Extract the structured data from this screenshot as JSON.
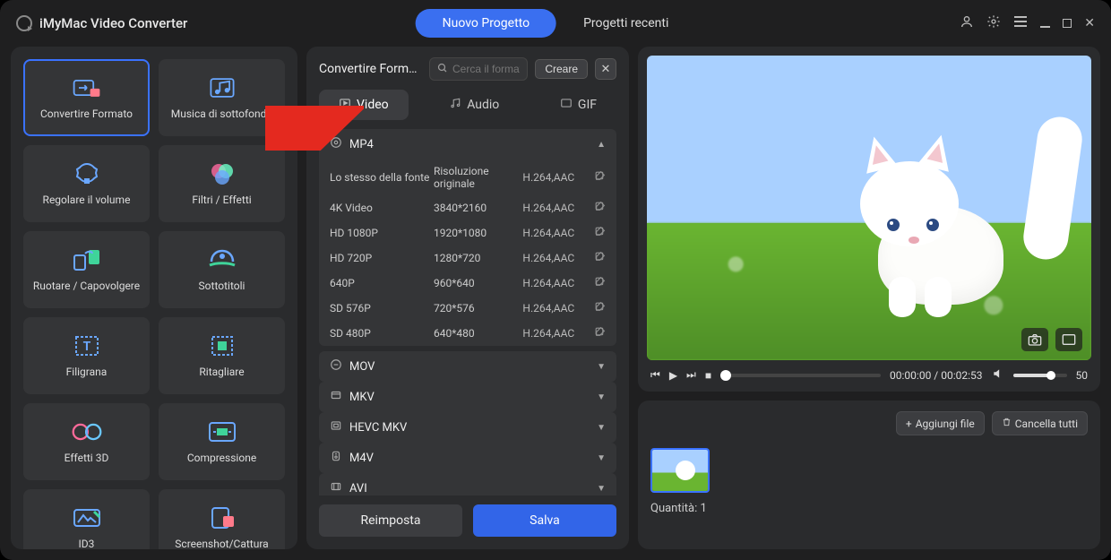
{
  "app": {
    "title": "iMyMac Video Converter"
  },
  "topTabs": {
    "new": "Nuovo Progetto",
    "recent": "Progetti recenti"
  },
  "tools": [
    {
      "id": "convert",
      "label": "Convertire Formato",
      "active": true
    },
    {
      "id": "bgmusic",
      "label": "Musica di sottofondo"
    },
    {
      "id": "volume",
      "label": "Regolare il volume"
    },
    {
      "id": "filters",
      "label": "Filtri / Effetti"
    },
    {
      "id": "rotate",
      "label": "Ruotare / Capovolgere"
    },
    {
      "id": "subs",
      "label": "Sottotitoli"
    },
    {
      "id": "watermark",
      "label": "Filigrana"
    },
    {
      "id": "crop",
      "label": "Ritagliare"
    },
    {
      "id": "fx3d",
      "label": "Effetti 3D"
    },
    {
      "id": "compress",
      "label": "Compressione"
    },
    {
      "id": "id3",
      "label": "ID3"
    },
    {
      "id": "screenshot",
      "label": "Screenshot/Cattura"
    }
  ],
  "center": {
    "title": "Convertire Forma...",
    "searchPlaceholder": "Cerca il formato",
    "create": "Creare",
    "tabs": {
      "video": "Video",
      "audio": "Audio",
      "gif": "GIF"
    },
    "expanded": {
      "name": "MP4",
      "presets": [
        {
          "name": "Lo stesso della fonte",
          "res": "Risoluzione originale",
          "codec": "H.264,AAC"
        },
        {
          "name": "4K Video",
          "res": "3840*2160",
          "codec": "H.264,AAC"
        },
        {
          "name": "HD 1080P",
          "res": "1920*1080",
          "codec": "H.264,AAC"
        },
        {
          "name": "HD 720P",
          "res": "1280*720",
          "codec": "H.264,AAC"
        },
        {
          "name": "640P",
          "res": "960*640",
          "codec": "H.264,AAC"
        },
        {
          "name": "SD 576P",
          "res": "720*576",
          "codec": "H.264,AAC"
        },
        {
          "name": "SD 480P",
          "res": "640*480",
          "codec": "H.264,AAC"
        }
      ]
    },
    "collapsed": [
      "MOV",
      "MKV",
      "HEVC MKV",
      "M4V",
      "AVI"
    ],
    "reset": "Reimposta",
    "save": "Salva"
  },
  "player": {
    "current": "00:00:00",
    "total": "00:02:53",
    "volume": "50"
  },
  "queue": {
    "add": "Aggiungi file",
    "clear": "Cancella tutti",
    "qtyText": "Quantità: 1"
  }
}
